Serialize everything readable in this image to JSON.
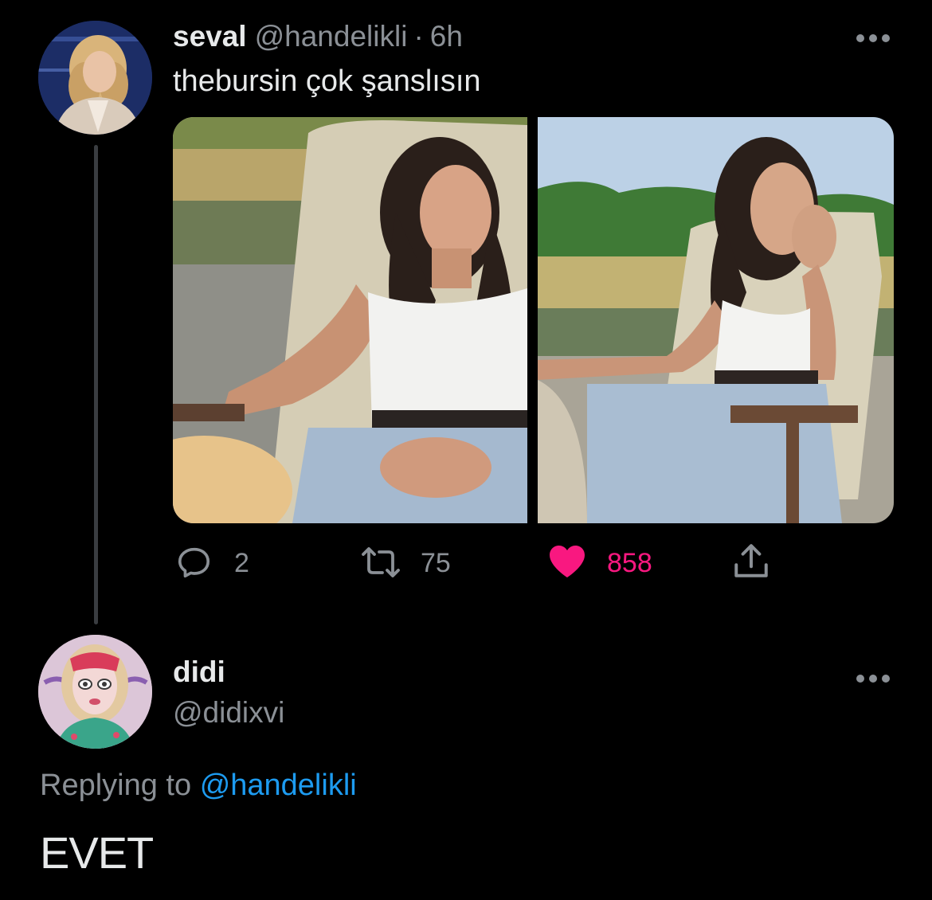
{
  "colors": {
    "background": "#000000",
    "primary_text": "#e7e9ea",
    "secondary_text": "#8b9096",
    "link": "#1d9bf0",
    "like": "#f91880",
    "thread_line": "#3a3d41"
  },
  "parent_tweet": {
    "display_name": "seval",
    "handle": "@handelikli",
    "separator": "·",
    "time": "6h",
    "text": "thebursin çok şanslısın",
    "avatar_icon": "avatar-seval",
    "more_icon": "more-horizontal-icon",
    "media": [
      {
        "icon": "photo-woman-smiling-in-chair-by-lake"
      },
      {
        "icon": "photo-woman-in-chair-hand-on-chin-by-lake"
      }
    ],
    "actions": {
      "reply": {
        "icon": "reply-icon",
        "count": "2"
      },
      "retweet": {
        "icon": "retweet-icon",
        "count": "75"
      },
      "like": {
        "icon": "heart-filled-icon",
        "count": "858",
        "liked": true
      },
      "share": {
        "icon": "share-icon"
      }
    }
  },
  "reply_tweet": {
    "display_name": "didi",
    "handle": "@didixvi",
    "avatar_icon": "avatar-didi",
    "more_icon": "more-horizontal-icon",
    "replying_prefix": "Replying to",
    "replying_to": "@handelikli",
    "text": "EVET"
  }
}
